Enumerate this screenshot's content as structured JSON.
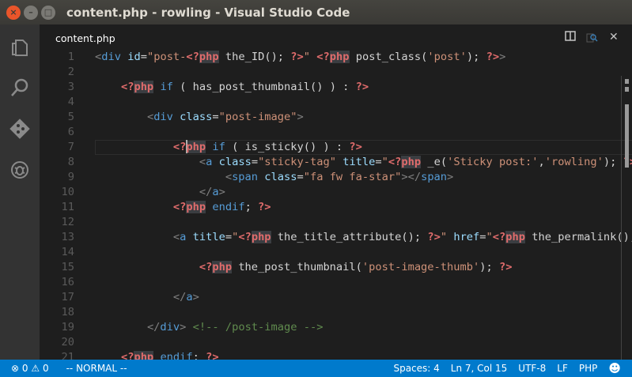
{
  "window": {
    "title": "content.php - rowling - Visual Studio Code"
  },
  "activity_bar": [
    "files-icon",
    "search-icon",
    "git-icon",
    "debug-icon"
  ],
  "tab": {
    "label": "content.php"
  },
  "editor": {
    "cursor": {
      "line": 7,
      "col": 15
    },
    "lines": [
      [
        [
          "tag",
          "<"
        ],
        [
          "name",
          "div"
        ],
        [
          "plain",
          " "
        ],
        [
          "attr",
          "id"
        ],
        [
          "plain",
          "="
        ],
        [
          "str",
          "\"post-"
        ],
        [
          "php",
          "<?"
        ],
        [
          "phpw",
          "php"
        ],
        [
          "plain",
          " the_ID(); "
        ],
        [
          "php",
          "?>"
        ],
        [
          "str",
          "\""
        ],
        [
          "plain",
          " "
        ],
        [
          "php",
          "<?"
        ],
        [
          "phpw",
          "php"
        ],
        [
          "plain",
          " post_class("
        ],
        [
          "str",
          "'post'"
        ],
        [
          "plain",
          "); "
        ],
        [
          "php",
          "?>"
        ],
        [
          "tag",
          ">"
        ]
      ],
      [],
      [
        [
          "plain",
          "    "
        ],
        [
          "php",
          "<?"
        ],
        [
          "phpw",
          "php"
        ],
        [
          "plain",
          " "
        ],
        [
          "kw",
          "if"
        ],
        [
          "plain",
          " ( has_post_thumbnail() ) : "
        ],
        [
          "php",
          "?>"
        ]
      ],
      [],
      [
        [
          "plain",
          "        "
        ],
        [
          "tag",
          "<"
        ],
        [
          "name",
          "div"
        ],
        [
          "plain",
          " "
        ],
        [
          "attr",
          "class"
        ],
        [
          "plain",
          "="
        ],
        [
          "str",
          "\"post-image\""
        ],
        [
          "tag",
          ">"
        ]
      ],
      [],
      [
        [
          "plain",
          "            "
        ],
        [
          "php",
          "<?"
        ],
        [
          "phpw",
          "php"
        ],
        [
          "plain",
          " "
        ],
        [
          "kw",
          "if"
        ],
        [
          "plain",
          " ( is_sticky() ) : "
        ],
        [
          "php",
          "?>"
        ]
      ],
      [
        [
          "plain",
          "                "
        ],
        [
          "tag",
          "<"
        ],
        [
          "name",
          "a"
        ],
        [
          "plain",
          " "
        ],
        [
          "attr",
          "class"
        ],
        [
          "plain",
          "="
        ],
        [
          "str",
          "\"sticky-tag\""
        ],
        [
          "plain",
          " "
        ],
        [
          "attr",
          "title"
        ],
        [
          "plain",
          "="
        ],
        [
          "str",
          "\""
        ],
        [
          "php",
          "<?"
        ],
        [
          "phpw",
          "php"
        ],
        [
          "plain",
          " _e("
        ],
        [
          "str",
          "'Sticky post:'"
        ],
        [
          "plain",
          ","
        ],
        [
          "str",
          "'rowling'"
        ],
        [
          "plain",
          "); "
        ],
        [
          "php",
          "?>"
        ],
        [
          "str",
          "\""
        ],
        [
          "tag",
          ">"
        ]
      ],
      [
        [
          "plain",
          "                    "
        ],
        [
          "tag",
          "<"
        ],
        [
          "name",
          "span"
        ],
        [
          "plain",
          " "
        ],
        [
          "attr",
          "class"
        ],
        [
          "plain",
          "="
        ],
        [
          "str",
          "\"fa fw fa-star\""
        ],
        [
          "tag",
          "></"
        ],
        [
          "name",
          "span"
        ],
        [
          "tag",
          ">"
        ]
      ],
      [
        [
          "plain",
          "                "
        ],
        [
          "tag",
          "</"
        ],
        [
          "name",
          "a"
        ],
        [
          "tag",
          ">"
        ]
      ],
      [
        [
          "plain",
          "            "
        ],
        [
          "php",
          "<?"
        ],
        [
          "phpw",
          "php"
        ],
        [
          "plain",
          " "
        ],
        [
          "kw",
          "endif"
        ],
        [
          "plain",
          "; "
        ],
        [
          "php",
          "?>"
        ]
      ],
      [],
      [
        [
          "plain",
          "            "
        ],
        [
          "tag",
          "<"
        ],
        [
          "name",
          "a"
        ],
        [
          "plain",
          " "
        ],
        [
          "attr",
          "title"
        ],
        [
          "plain",
          "="
        ],
        [
          "str",
          "\""
        ],
        [
          "php",
          "<?"
        ],
        [
          "phpw",
          "php"
        ],
        [
          "plain",
          " the_title_attribute(); "
        ],
        [
          "php",
          "?>"
        ],
        [
          "str",
          "\""
        ],
        [
          "plain",
          " "
        ],
        [
          "attr",
          "href"
        ],
        [
          "plain",
          "="
        ],
        [
          "str",
          "\""
        ],
        [
          "php",
          "<?"
        ],
        [
          "phpw",
          "php"
        ],
        [
          "plain",
          " the_permalink(); "
        ],
        [
          "php",
          "?>"
        ],
        [
          "str",
          "\""
        ],
        [
          "tag",
          ">"
        ]
      ],
      [],
      [
        [
          "plain",
          "                "
        ],
        [
          "php",
          "<?"
        ],
        [
          "phpw",
          "php"
        ],
        [
          "plain",
          " the_post_thumbnail("
        ],
        [
          "str",
          "'post-image-thumb'"
        ],
        [
          "plain",
          "); "
        ],
        [
          "php",
          "?>"
        ]
      ],
      [],
      [
        [
          "plain",
          "            "
        ],
        [
          "tag",
          "</"
        ],
        [
          "name",
          "a"
        ],
        [
          "tag",
          ">"
        ]
      ],
      [],
      [
        [
          "plain",
          "        "
        ],
        [
          "tag",
          "</"
        ],
        [
          "name",
          "div"
        ],
        [
          "tag",
          ">"
        ],
        [
          "plain",
          " "
        ],
        [
          "comment",
          "<!-- /post-image -->"
        ]
      ],
      [],
      [
        [
          "plain",
          "    "
        ],
        [
          "php",
          "<?"
        ],
        [
          "phpw",
          "php"
        ],
        [
          "plain",
          " "
        ],
        [
          "kw",
          "endif"
        ],
        [
          "plain",
          "; "
        ],
        [
          "php",
          "?>"
        ]
      ]
    ]
  },
  "status": {
    "errors": "0",
    "warnings": "0",
    "mode": "-- NORMAL --",
    "spaces": "Spaces: 4",
    "position": "Ln 7, Col 15",
    "encoding": "UTF-8",
    "eol": "LF",
    "language": "PHP"
  },
  "colors": {
    "status_bg": "#007acc",
    "editor_bg": "#1e1e1e",
    "activity_bg": "#333333"
  }
}
